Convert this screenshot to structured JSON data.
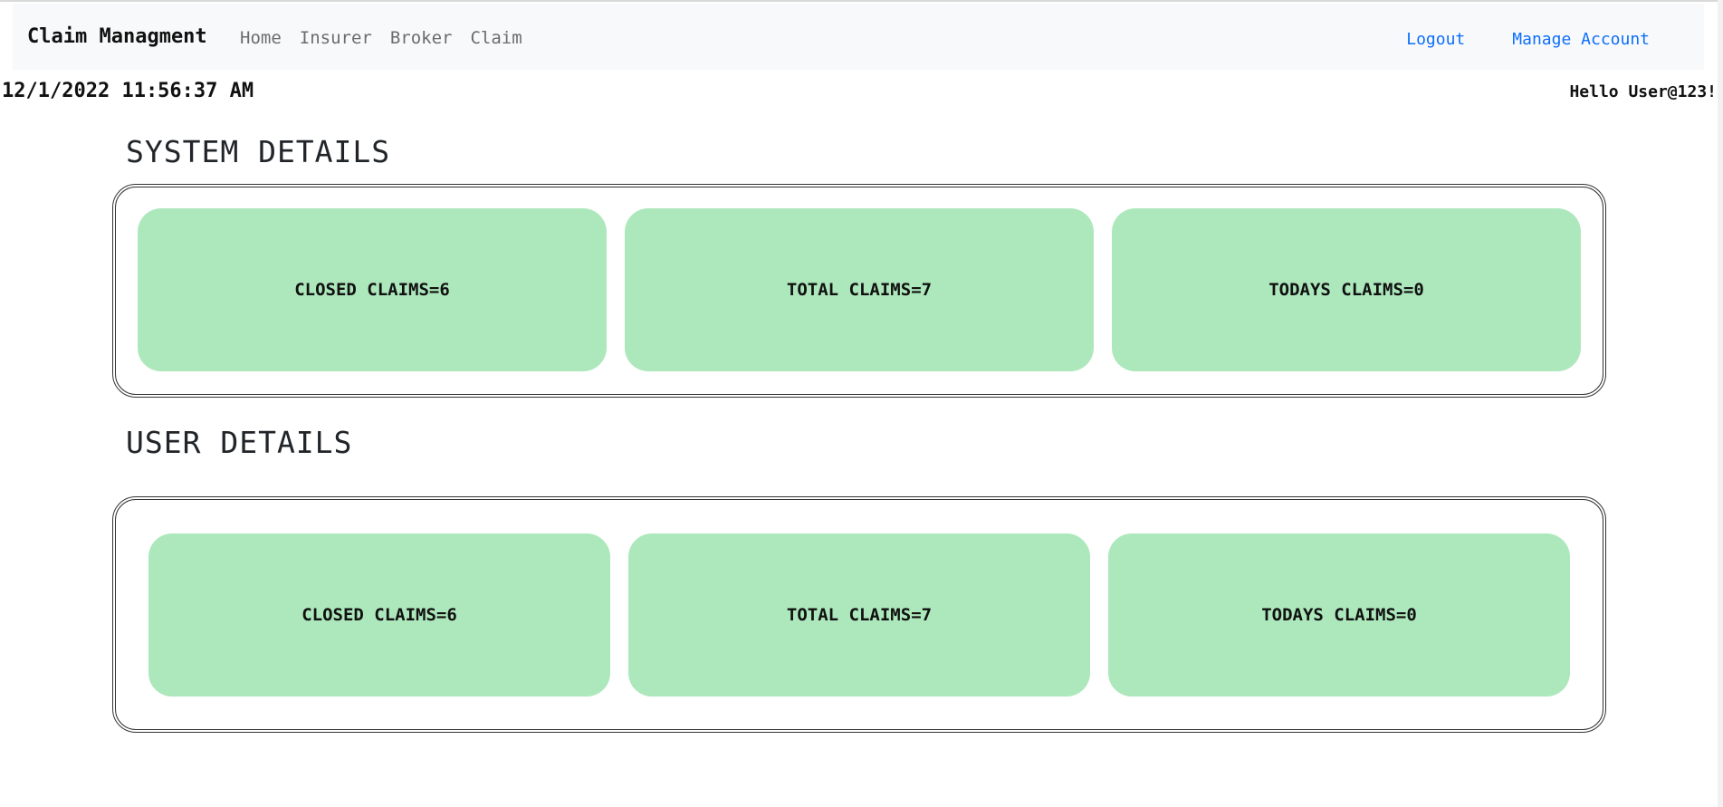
{
  "navbar": {
    "brand": "Claim Managment",
    "links": [
      {
        "label": "Home"
      },
      {
        "label": "Insurer"
      },
      {
        "label": "Broker"
      },
      {
        "label": "Claim"
      }
    ],
    "logout_label": "Logout",
    "manage_account_label": "Manage Account"
  },
  "header": {
    "timestamp": "12/1/2022 11:56:37 AM",
    "greeting": "Hello User@123!"
  },
  "system_details": {
    "title": "SYSTEM DETAILS",
    "cards": [
      {
        "label": "CLOSED CLAIMS=6"
      },
      {
        "label": "TOTAL CLAIMS=7"
      },
      {
        "label": "TODAYS CLAIMS=0"
      }
    ]
  },
  "user_details": {
    "title": "USER DETAILS",
    "cards": [
      {
        "label": "CLOSED CLAIMS=6"
      },
      {
        "label": "TOTAL CLAIMS=7"
      },
      {
        "label": "TODAYS CLAIMS=0"
      }
    ]
  },
  "colors": {
    "card_background": "#ade8bc",
    "link": "#0d6efd",
    "navbar_background": "#f8f9fa"
  }
}
